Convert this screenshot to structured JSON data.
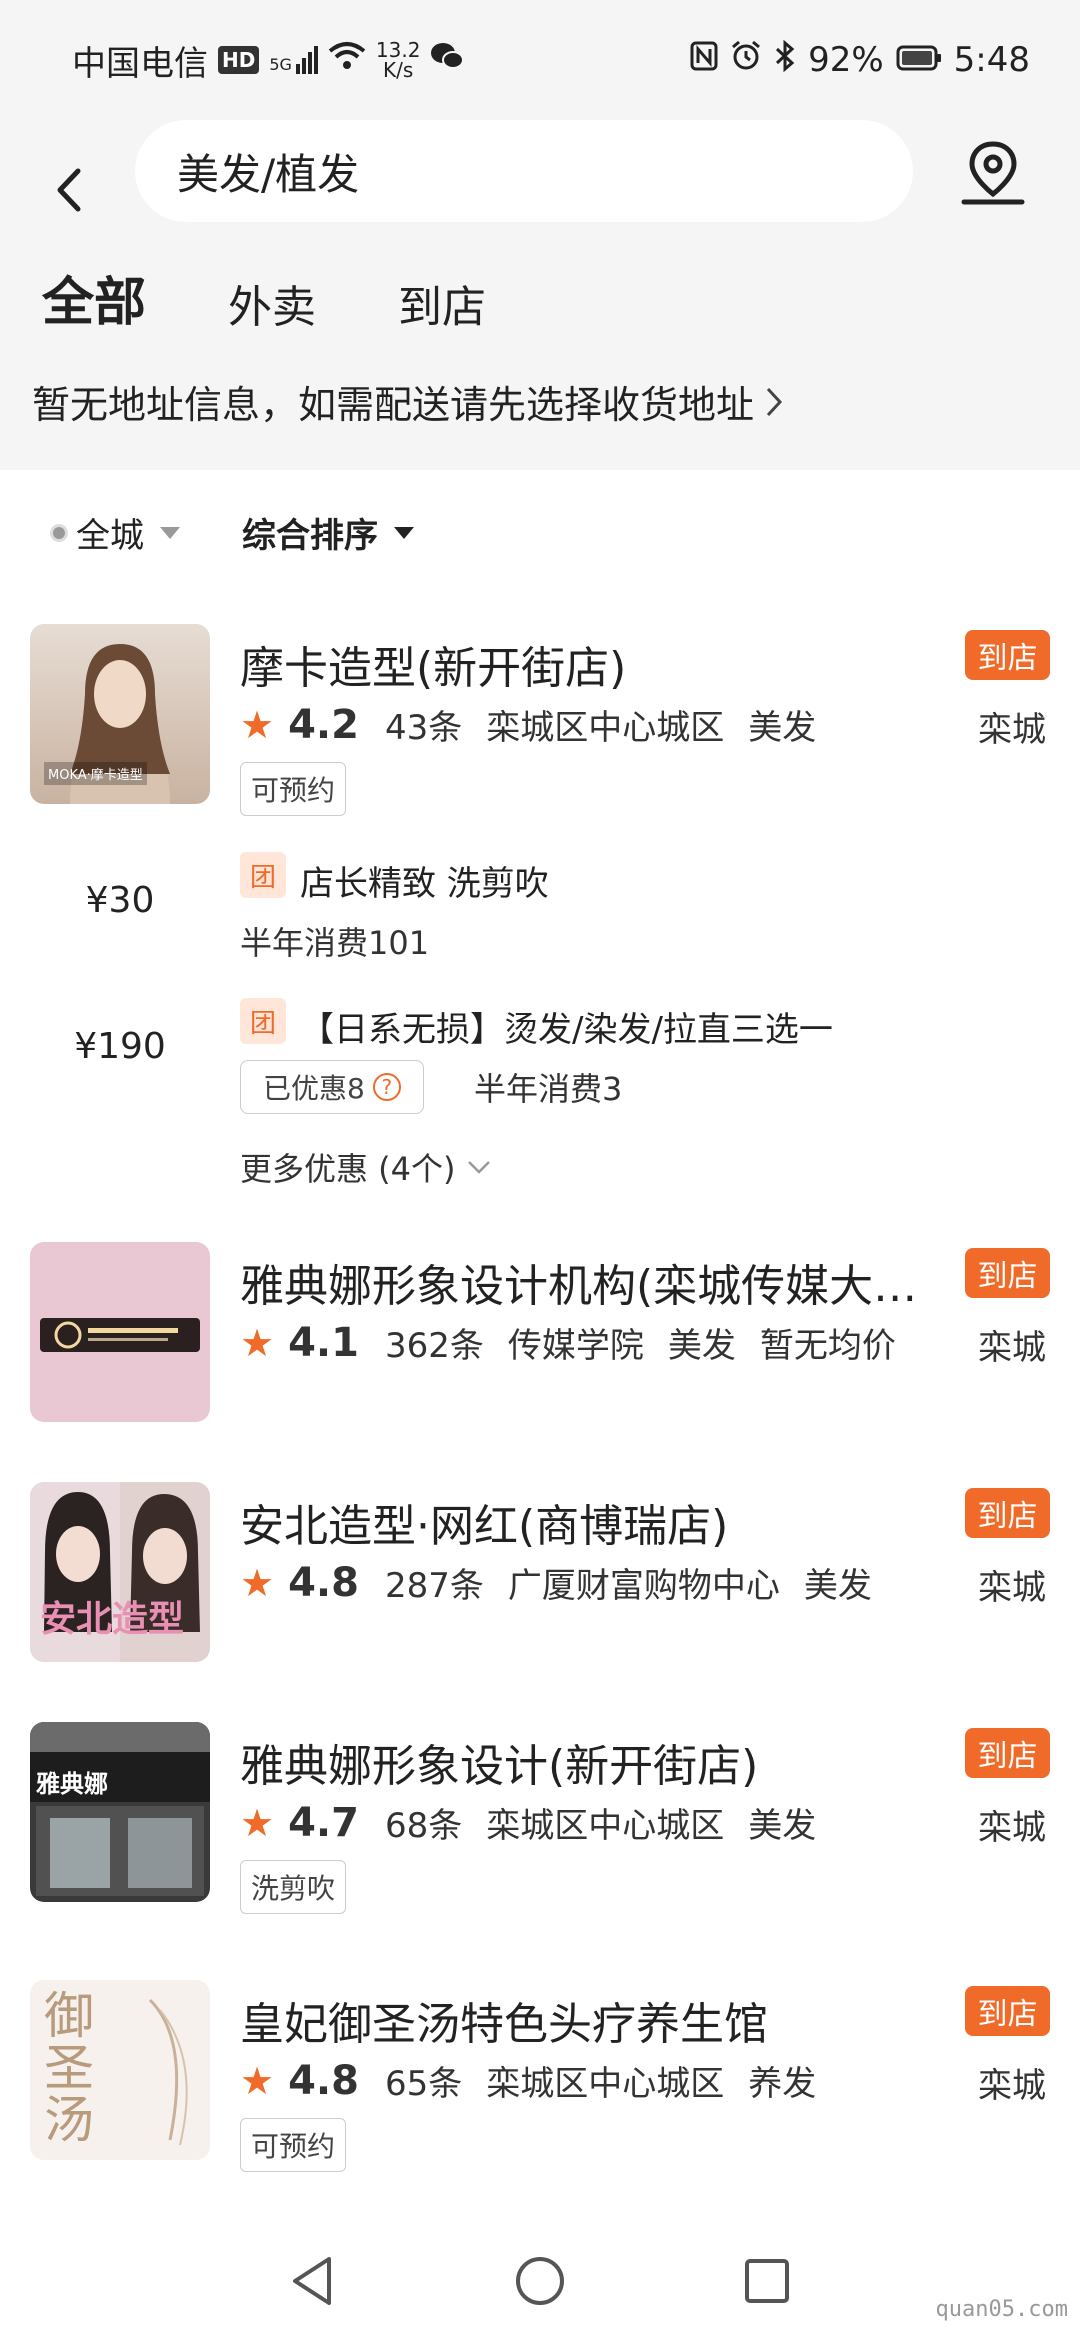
{
  "status_bar": {
    "carrier": "中国电信",
    "hd": "HD",
    "signal": "5G",
    "speed_value": "13.2",
    "speed_unit": "K/s",
    "battery": "92%",
    "time": "5:48"
  },
  "search": {
    "query": "美发/植发"
  },
  "tabs": [
    {
      "label": "全部",
      "active": true
    },
    {
      "label": "外卖",
      "active": false
    },
    {
      "label": "到店",
      "active": false
    }
  ],
  "address_notice": "暂无地址信息，如需配送请先选择收货地址",
  "filters": {
    "region": "全城",
    "sort": "综合排序"
  },
  "shops": [
    {
      "name": "摩卡造型(新开街店)",
      "badge": "到店",
      "rating": "4.2",
      "reviews": "43条",
      "area": "栾城区中心城区",
      "category": "美发",
      "city": "栾城",
      "tag": "可预约",
      "thumb_caption": "MOKA·摩卡造型",
      "deals": [
        {
          "price": "¥30",
          "icon": "团",
          "title": "店长精致 洗剪吹",
          "sub": "半年消费101"
        },
        {
          "price": "¥190",
          "icon": "团",
          "title": "【日系无损】烫发/染发/拉直三选一",
          "discount": "已优惠8",
          "discount_icon": "?",
          "sub": "半年消费3"
        }
      ],
      "more": "更多优惠 (4个)"
    },
    {
      "name": "雅典娜形象设计机构(栾城传媒大…",
      "badge": "到店",
      "rating": "4.1",
      "reviews": "362条",
      "area": "传媒学院",
      "category": "美发",
      "extra": "暂无均价",
      "city": "栾城"
    },
    {
      "name": "安北造型·网红(商博瑞店)",
      "badge": "到店",
      "rating": "4.8",
      "reviews": "287条",
      "area": "广厦财富购物中心",
      "category": "美发",
      "city": "栾城",
      "thumb_caption": "安北造型"
    },
    {
      "name": "雅典娜形象设计(新开街店)",
      "badge": "到店",
      "rating": "4.7",
      "reviews": "68条",
      "area": "栾城区中心城区",
      "category": "美发",
      "city": "栾城",
      "tag": "洗剪吹",
      "thumb_caption": "雅典娜"
    },
    {
      "name": "皇妃御圣汤特色头疗养生馆",
      "badge": "到店",
      "rating": "4.8",
      "reviews": "65条",
      "area": "栾城区中心城区",
      "category": "养发",
      "city": "栾城",
      "tag": "可预约",
      "thumb_caption": "御圣汤"
    }
  ],
  "watermark": "quan05.com",
  "colors": {
    "accent": "#f06a2a",
    "tab_underline": "#ffd100",
    "header_bg": "#f5f5f5"
  }
}
